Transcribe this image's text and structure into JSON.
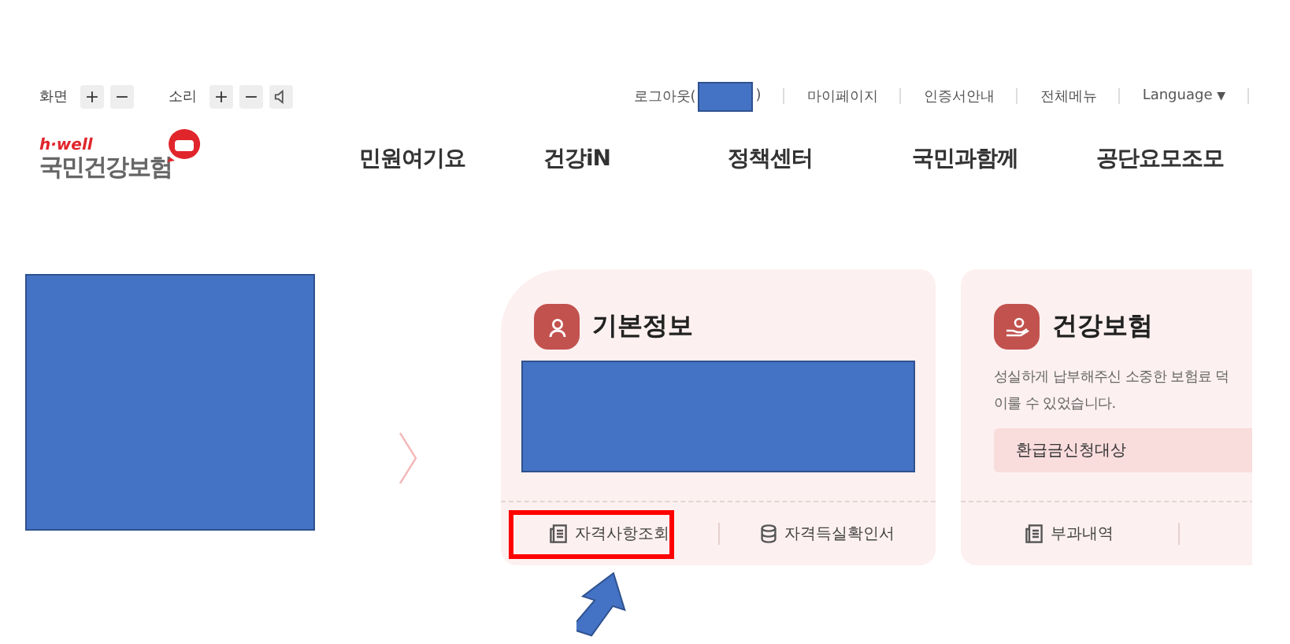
{
  "top_bar": {
    "screen_label": "화면",
    "screen_buttons": [
      "+",
      "−"
    ],
    "sound_label": "소리",
    "sound_buttons": [
      "+",
      "−"
    ],
    "logout": {
      "before": "로그아웃(",
      "after": ")"
    },
    "links": [
      "마이페이지",
      "인증서안내",
      "전체메뉴"
    ],
    "language": {
      "label": "Language",
      "caret": "▼"
    }
  },
  "logo": {
    "tagline": "h·well",
    "name": "국민건강보험"
  },
  "nav": [
    "민원여기요",
    "건강iN",
    "정책센터",
    "국민과함께",
    "공단요모조모"
  ],
  "cards": [
    {
      "title": "기본정보",
      "body": {
        "kind": "redacted"
      },
      "links": [
        {
          "label": "자격사항조회",
          "kind": "document",
          "highlighted": true
        },
        {
          "label": "자격득실확인서",
          "kind": "database",
          "highlighted": false
        }
      ]
    },
    {
      "title": "건강보험",
      "body": {
        "kind": "notice",
        "lines": [
          "성실하게 납부해주신 소중한 보험료 덕",
          "이룰 수 있었습니다."
        ],
        "tag": "환급금신청대상"
      },
      "links": [
        {
          "label": "부과내역",
          "kind": "document",
          "highlighted": false
        }
      ]
    }
  ]
}
